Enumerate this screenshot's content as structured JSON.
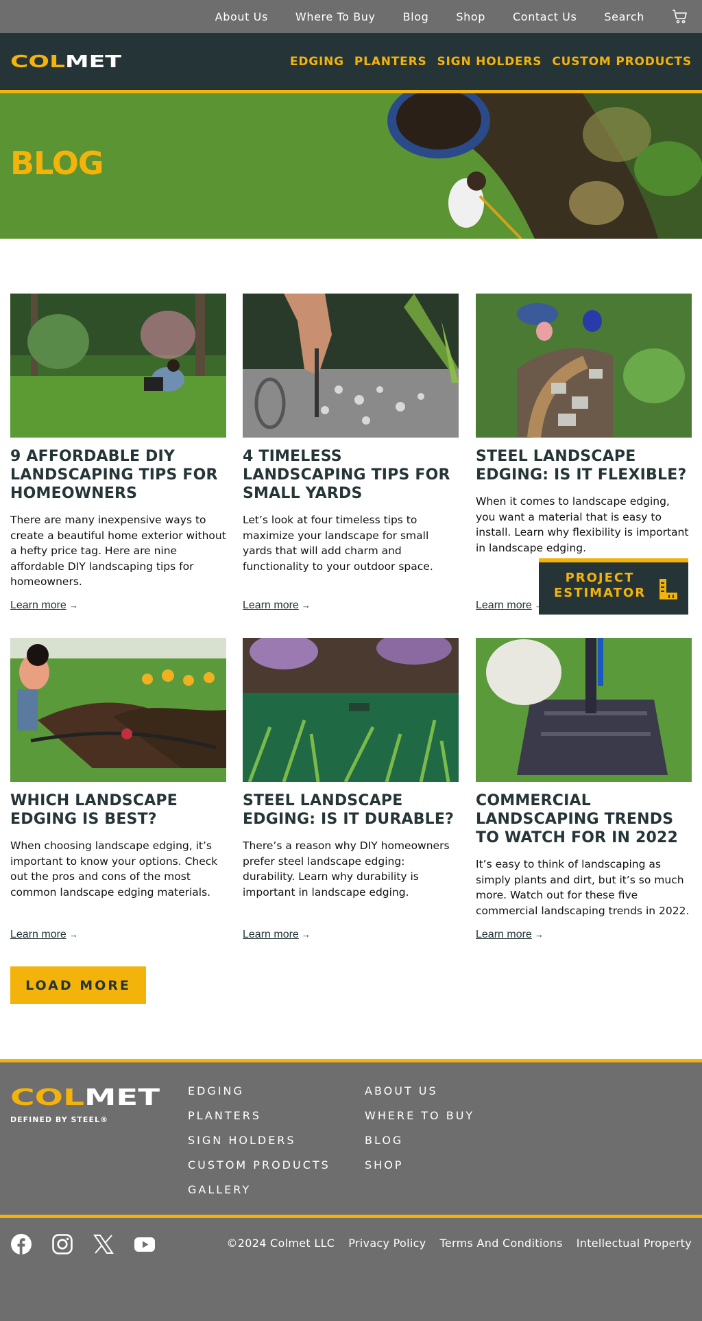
{
  "utility_nav": [
    "About Us",
    "Where To Buy",
    "Blog",
    "Shop",
    "Contact Us",
    "Search"
  ],
  "brand": {
    "logo_text": "COLMET",
    "tagline": "DEFINED BY STEEL®"
  },
  "main_nav": [
    "EDGING",
    "PLANTERS",
    "SIGN HOLDERS",
    "CUSTOM PRODUCTS"
  ],
  "hero": {
    "title": "BLOG"
  },
  "posts": [
    {
      "title": "9 AFFORDABLE DIY LANDSCAPING TIPS FOR HOMEOWNERS",
      "excerpt": "There are many inexpensive ways to create a beautiful home exterior without a hefty price tag. Here are nine affordable DIY landscaping tips for homeowners.",
      "link": "Learn more"
    },
    {
      "title": "4 TIMELESS LANDSCAPING TIPS FOR SMALL YARDS",
      "excerpt": "Let’s look at four timeless tips to maximize your landscape for small yards that will add charm and functionality to your outdoor space.",
      "link": "Learn more"
    },
    {
      "title": "STEEL LANDSCAPE EDGING: IS IT FLEXIBLE?",
      "excerpt": "When it comes to landscape edging, you want a material that is easy to install. Learn why flexibility is important in landscape edging.",
      "link": "Learn more"
    },
    {
      "title": "WHICH LANDSCAPE EDGING IS BEST?",
      "excerpt": "When choosing landscape edging, it’s important to know your options. Check out the pros and cons of the most common landscape edging materials.",
      "link": "Learn more"
    },
    {
      "title": "STEEL LANDSCAPE EDGING: IS IT DURABLE?",
      "excerpt": "There’s a reason why DIY homeowners prefer steel landscape edging: durability. Learn why durability is important in landscape edging.",
      "link": "Learn more"
    },
    {
      "title": "COMMERCIAL LANDSCAPING TRENDS TO WATCH FOR IN 2022",
      "excerpt": "It’s easy to think of landscaping as simply plants and dirt, but it’s so much more. Watch out for these five commercial landscaping trends in 2022.",
      "link": "Learn more"
    }
  ],
  "estimator_label": "PROJECT ESTIMATOR",
  "load_more_label": "LOAD MORE",
  "footer": {
    "col1": [
      "EDGING",
      "PLANTERS",
      "SIGN HOLDERS",
      "CUSTOM PRODUCTS",
      "GALLERY"
    ],
    "col2": [
      "ABOUT US",
      "WHERE TO BUY",
      "BLOG",
      "SHOP"
    ],
    "socials": [
      "facebook-icon",
      "instagram-icon",
      "x-icon",
      "youtube-icon"
    ],
    "copyright": "©2024 Colmet LLC",
    "legal": [
      "Privacy Policy",
      "Terms And Conditions",
      "Intellectual Property"
    ]
  },
  "colors": {
    "accent": "#f4b30a",
    "dark": "#253537",
    "gray": "#6e6e6e"
  }
}
